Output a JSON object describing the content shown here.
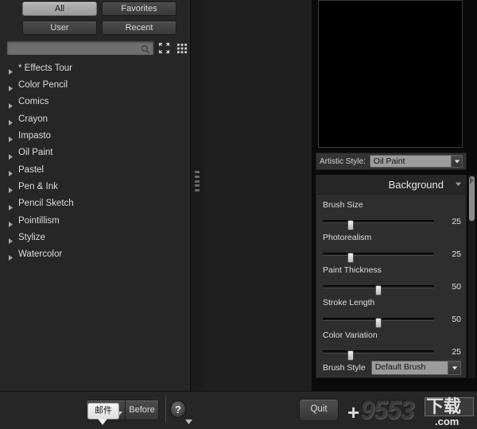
{
  "colors": {
    "panel_bg": "#262626",
    "right_panel_bg": "#0a0a0a",
    "slider_panel_bg": "#2e2e2e",
    "selected_button": "#a0a0a0",
    "text": "#dcdcdc",
    "preview_bg": "#000000",
    "accent_thumb": "#f2f2f2"
  },
  "left_panel": {
    "filters": [
      {
        "label": "All",
        "selected": true
      },
      {
        "label": "Favorites",
        "selected": false
      },
      {
        "label": "User",
        "selected": false
      },
      {
        "label": "Recent",
        "selected": false
      }
    ],
    "search": {
      "value": "",
      "placeholder": "",
      "icon": "search-icon"
    },
    "toolbar_icons": [
      {
        "name": "collapse-all-icon",
        "label": "Collapse All"
      },
      {
        "name": "grid-view-icon",
        "label": "Grid View"
      }
    ],
    "tree_items": [
      {
        "label": "* Effects Tour",
        "expanded": false
      },
      {
        "label": "Color Pencil",
        "expanded": false
      },
      {
        "label": "Comics",
        "expanded": false
      },
      {
        "label": "Crayon",
        "expanded": false
      },
      {
        "label": "Impasto",
        "expanded": false
      },
      {
        "label": "Oil Paint",
        "expanded": false
      },
      {
        "label": "Pastel",
        "expanded": false
      },
      {
        "label": "Pen & Ink",
        "expanded": false
      },
      {
        "label": "Pencil Sketch",
        "expanded": false
      },
      {
        "label": "Pointillism",
        "expanded": false
      },
      {
        "label": "Stylize",
        "expanded": false
      },
      {
        "label": "Watercolor",
        "expanded": false
      }
    ]
  },
  "right_panel": {
    "artistic_style": {
      "label": "Artistic Style:",
      "value": "Oil Paint"
    },
    "section": {
      "title": "Background",
      "collapse_icon": "chevron-down-icon"
    },
    "sliders": [
      {
        "name": "Brush Size",
        "value": "25",
        "percent": 25
      },
      {
        "name": "Photorealism",
        "value": "25",
        "percent": 25
      },
      {
        "name": "Paint Thickness",
        "value": "50",
        "percent": 50
      },
      {
        "name": "Stroke Length",
        "value": "50",
        "percent": 50
      },
      {
        "name": "Color Variation",
        "value": "25",
        "percent": 25
      }
    ],
    "brush_style": {
      "label": "Brush Style",
      "value": "Default Brush"
    },
    "scrollbar": {
      "name": "panel-vertical-scrollbar"
    },
    "expand_arrow": "chevron-right-icon"
  },
  "bottom_bar": {
    "mail_button": {
      "name": "mail-button",
      "has_dropdown": true
    },
    "tooltip": {
      "text": "邮件"
    },
    "before_button": {
      "label": "Before"
    },
    "help_button": {
      "glyph": "?",
      "has_dropdown": true
    },
    "quit_button": {
      "label": "Quit"
    }
  },
  "watermark": {
    "plus": "+",
    "number": "9553",
    "chinese": "下载",
    "domain": ".com"
  }
}
